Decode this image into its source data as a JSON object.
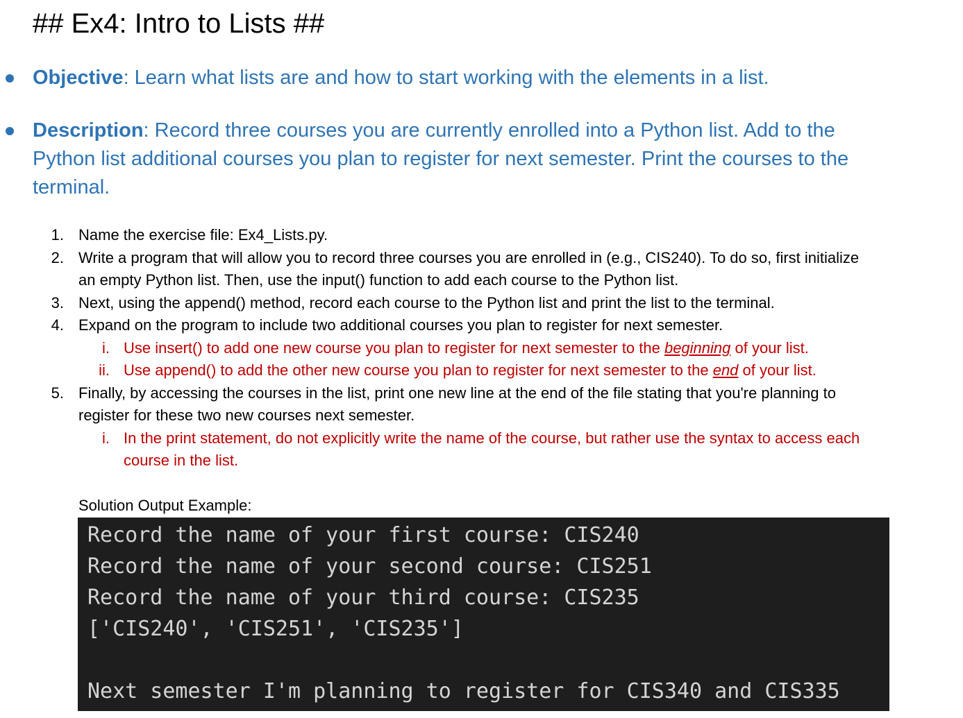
{
  "heading": "## Ex4: Intro to Lists ##",
  "objective": {
    "label": "Objective",
    "text": ": Learn what lists are and how to start working with the elements in a list."
  },
  "description": {
    "label": "Description",
    "line1": ": Record three courses you are currently enrolled into a Python list. Add to the",
    "line2": "Python list additional courses you plan to register for next semester. Print the courses to the",
    "line3": "terminal."
  },
  "steps": [
    {
      "num": "1.",
      "lines": [
        "Name the exercise file: Ex4_Lists.py."
      ]
    },
    {
      "num": "2.",
      "lines": [
        "Write a program that will allow you to record three courses you are enrolled in (e.g., CIS240). To do so, first initialize",
        "an empty Python list. Then, use the input() function to add each course to the Python list."
      ]
    },
    {
      "num": "3.",
      "lines": [
        "Next, using the append() method, record each course to the Python list and print the list to the terminal."
      ]
    },
    {
      "num": "4.",
      "lines": [
        "Expand on the program to include two additional courses you plan to register for next semester."
      ]
    },
    {
      "num": "5.",
      "lines": [
        "Finally, by accessing the courses in the list, print one new line at the end of the file stating that you're planning to",
        "register for these two new courses next semester."
      ]
    }
  ],
  "substeps_4": [
    {
      "num": "i.",
      "before": "Use insert() to add one new course you plan to register for next semester to the ",
      "emph": "beginning",
      "after": " of your list."
    },
    {
      "num": "ii.",
      "before": "Use append() to add the other new course you plan to register for next semester to the ",
      "emph": "end",
      "after": " of your list."
    }
  ],
  "substeps_5": [
    {
      "num": "i.",
      "lines": [
        "In the print statement, do not explicitly write the name of the course, but rather use the syntax to access each",
        "course in the list."
      ]
    }
  ],
  "solution_label": "Solution Output Example:",
  "terminal_lines": [
    "Record the name of your first course: CIS240",
    "Record the name of your second course: CIS251",
    "Record the name of your third course: CIS235",
    "['CIS240', 'CIS251', 'CIS235']",
    "",
    "Next semester I'm planning to register for CIS340 and CIS335"
  ],
  "colors": {
    "heading_blue": "#2e74b5",
    "red": "#c00000",
    "terminal_bg": "#1e1e1e",
    "terminal_text": "#d4d4d4"
  }
}
